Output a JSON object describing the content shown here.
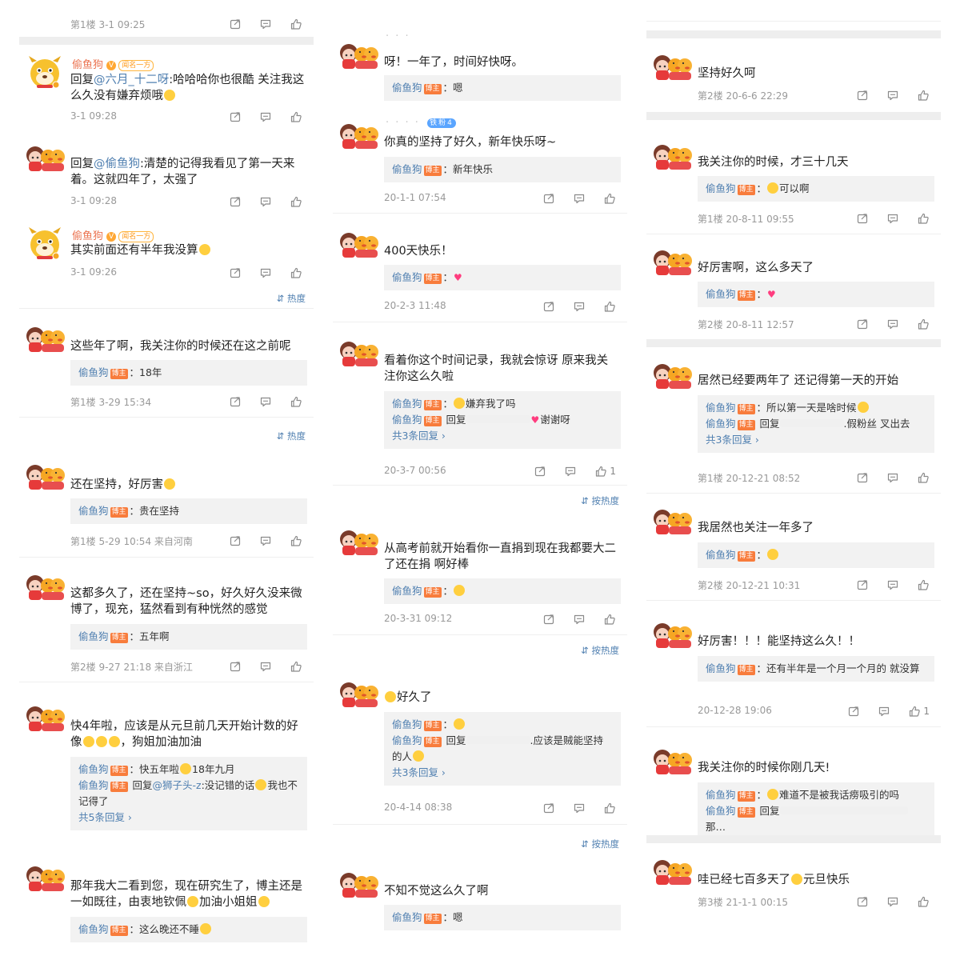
{
  "theme": {
    "link": "#4f7fb0",
    "author_tag_bg": "#f87c3c",
    "reply_bg": "#f2f2f2",
    "separator": "#eeeeee",
    "meta_text": "#999999"
  },
  "icons": {
    "share": "share-icon",
    "comment": "comment-icon",
    "like": "like-icon",
    "sort": "sort-icon",
    "more": "chevron-right-icon"
  },
  "labels": {
    "author_tag": "博主",
    "sort_hot": "热度",
    "sort_by_hot": "按热度",
    "fan_badge": "铁粉4",
    "vip": "V",
    "crown": "闻名一方"
  },
  "col1": {
    "c0": {
      "meta": "第1楼 3-1 09:25"
    },
    "c1": {
      "name": "偷鱼狗",
      "body_reply": "回复",
      "body_at": "@六月_十二呀",
      "body_text": ":哈哈哈你也很酷 关注我这么久没有嫌弃烦哦",
      "meta": "3-1 09:28"
    },
    "c2": {
      "body_reply": "回复",
      "body_at": "@偷鱼狗",
      "body_text": ":清楚的记得我看见了第一天来着。这就四年了，太强了",
      "meta": "3-1 09:28"
    },
    "c3": {
      "name": "偷鱼狗",
      "body": "其实前面还有半年我没算",
      "meta": "3-1 09:26"
    },
    "c4": {
      "body": "这些年了啊，我关注你的时候还在这之前呢",
      "r1_name": "偷鱼狗",
      "r1_text": "：18年",
      "meta": "第1楼 3-29 15:34"
    },
    "c5": {
      "body": "还在坚持，好厉害",
      "r1_name": "偷鱼狗",
      "r1_text": "：贵在坚持",
      "meta": "第1楼 5-29 10:54 来自河南"
    },
    "c6": {
      "body": "这都多久了，还在坚持~so，好久好久没来微博了，现充，猛然看到有种恍然的感觉",
      "r1_name": "偷鱼狗",
      "r1_text": "：五年啊",
      "meta": "第2楼 9-27 21:18 来自浙江"
    },
    "c7": {
      "body": "快4年啦，应该是从元旦前几天开始计数的好像",
      "body_tail": "，狗姐加油加油",
      "r1_name": "偷鱼狗",
      "r1_text": "：快五年啦",
      "r1_tail": "18年九月",
      "r2_name": "偷鱼狗",
      "r2_reply": " 回复",
      "r2_at": "@狮子头-z",
      "r2_text": ":没记错的话",
      "r2_tail": "我也不记得了",
      "more": "共5条回复 ›"
    },
    "c8": {
      "body": "那年我大二看到您，现在研究生了，博主还是一如既往，由衷地钦佩",
      "body_tail": "加油小姐姐",
      "r1_name": "偷鱼狗",
      "r1_text": "：这么晚还不睡"
    }
  },
  "col2": {
    "c1": {
      "body": "呀！一年了，时间好快呀。",
      "r1_name": "偷鱼狗",
      "r1_text": "：嗯"
    },
    "c2": {
      "body": "你真的坚持了好久，新年快乐呀~",
      "r1_name": "偷鱼狗",
      "r1_text": "：新年快乐",
      "meta": "20-1-1 07:54"
    },
    "c3": {
      "body": "400天快乐！",
      "r1_name": "偷鱼狗",
      "r1_text": "：",
      "meta": "20-2-3 11:48"
    },
    "c4": {
      "body": "看着你这个时间记录，我就会惊讶 原来我关注你这么久啦",
      "r1_name": "偷鱼狗",
      "r1_text": "：",
      "r1_tail": "嫌弃我了吗",
      "r2_name": "偷鱼狗",
      "r2_reply": " 回复",
      "r2_text": "谢谢呀",
      "more": "共3条回复 ›",
      "meta": "20-3-7 00:56",
      "likes": "1"
    },
    "c5": {
      "body": "从高考前就开始看你一直捐到现在我都要大二了还在捐 啊好棒",
      "r1_name": "偷鱼狗",
      "r1_text": "：",
      "meta": "20-3-31 09:12"
    },
    "c6": {
      "body": "好久了",
      "r1_name": "偷鱼狗",
      "r1_text": "：",
      "r2_name": "偷鱼狗",
      "r2_reply": " 回复",
      "r2_text": ".应该是贼能坚持的人",
      "more": "共3条回复 ›",
      "meta": "20-4-14 08:38"
    },
    "c7": {
      "body": "不知不觉这么久了啊",
      "r1_name": "偷鱼狗",
      "r1_text": "：嗯"
    }
  },
  "col3": {
    "c1": {
      "body": "坚持好久呵",
      "meta": "第2楼 20-6-6 22:29"
    },
    "c2": {
      "body": "我关注你的时候，才三十几天",
      "r1_name": "偷鱼狗",
      "r1_text": "：",
      "r1_tail": "可以啊",
      "meta": "第1楼 20-8-11 09:55"
    },
    "c3": {
      "body": "好厉害啊，这么多天了",
      "r1_name": "偷鱼狗",
      "r1_text": "：",
      "meta": "第2楼 20-8-11 12:57"
    },
    "c4": {
      "body": "居然已经要两年了 还记得第一天的开始",
      "r1_name": "偷鱼狗",
      "r1_text": "：所以第一天是啥时候",
      "r2_name": "偷鱼狗",
      "r2_reply": " 回复",
      "r2_text": ".假粉丝 叉出去",
      "more": "共3条回复 ›",
      "meta": "第1楼 20-12-21 08:52"
    },
    "c5": {
      "body": "我居然也关注一年多了",
      "r1_name": "偷鱼狗",
      "r1_text": "：",
      "meta": "第2楼 20-12-21 10:31"
    },
    "c6": {
      "body": "好厉害！！！能坚持这么久！！",
      "r1_name": "偷鱼狗",
      "r1_text": "：还有半年是一个月一个月的 就没算",
      "meta": "20-12-28 19:06",
      "likes": "1"
    },
    "c7": {
      "body": "我关注你的时候你刚几天!",
      "r1_name": "偷鱼狗",
      "r1_text": "：",
      "r1_tail": "难道不是被我话痨吸引的吗",
      "r2_name": "偷鱼狗",
      "r2_reply": " 回复",
      "r2_tail": "那…"
    },
    "c8": {
      "body": "哇已经七百多天了",
      "body_tail": "元旦快乐",
      "meta": "第3楼 21-1-1 00:15"
    }
  }
}
